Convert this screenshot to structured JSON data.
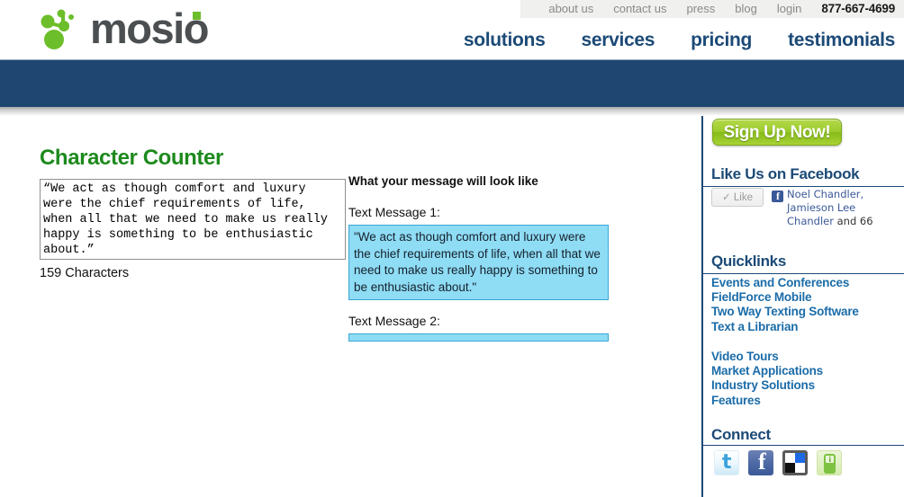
{
  "topnav": {
    "items": [
      {
        "label": "about us"
      },
      {
        "label": "contact us"
      },
      {
        "label": "press"
      },
      {
        "label": "blog"
      },
      {
        "label": "login"
      }
    ],
    "phone": "877-667-4699"
  },
  "logo": {
    "text": "mosio"
  },
  "mainnav": {
    "items": [
      {
        "label": "solutions"
      },
      {
        "label": "services"
      },
      {
        "label": "pricing"
      },
      {
        "label": "testimonials"
      }
    ]
  },
  "main": {
    "page_title": "Character Counter",
    "textarea_value": "“We act as though comfort and luxury were the chief requirements of life, when all that we need to make us really happy is something to be enthusiastic about.”",
    "char_count": "159 Characters"
  },
  "preview": {
    "heading": "What your message will look like",
    "messages": [
      {
        "label": "Text Message 1:",
        "text": "\"We act as though comfort and luxury were the chief requirements of life, when all that we need to make us really happy is something to be enthusiastic about.\""
      },
      {
        "label": "Text Message 2:",
        "text": ""
      }
    ]
  },
  "sidebar": {
    "signup_label": "Sign Up Now!",
    "facebook": {
      "heading": "Like Us on Facebook",
      "like_label": "✓ Like",
      "names_links": "Noel Chandler, Jamieson Lee Chandler",
      "names_tail": " and 66"
    },
    "quicklinks": {
      "heading": "Quicklinks",
      "group1": [
        {
          "label": "Events and Conferences"
        },
        {
          "label": "FieldForce Mobile"
        },
        {
          "label": "Two Way Texting Software"
        },
        {
          "label": "Text a Librarian"
        }
      ],
      "group2": [
        {
          "label": "Video Tours"
        },
        {
          "label": "Market Applications"
        },
        {
          "label": "Industry Solutions"
        },
        {
          "label": "Features"
        }
      ]
    },
    "connect": {
      "heading": "Connect",
      "icons": [
        {
          "name": "twitter-icon"
        },
        {
          "name": "facebook-icon"
        },
        {
          "name": "delicious-icon"
        },
        {
          "name": "mobile-info-icon"
        }
      ]
    }
  },
  "colors": {
    "navy": "#1e4671",
    "link_blue": "#1b6ca8",
    "heading_green": "#1d8a1d",
    "sms_blue": "#8fdcf5",
    "signup_green": "#9ccb2c"
  }
}
